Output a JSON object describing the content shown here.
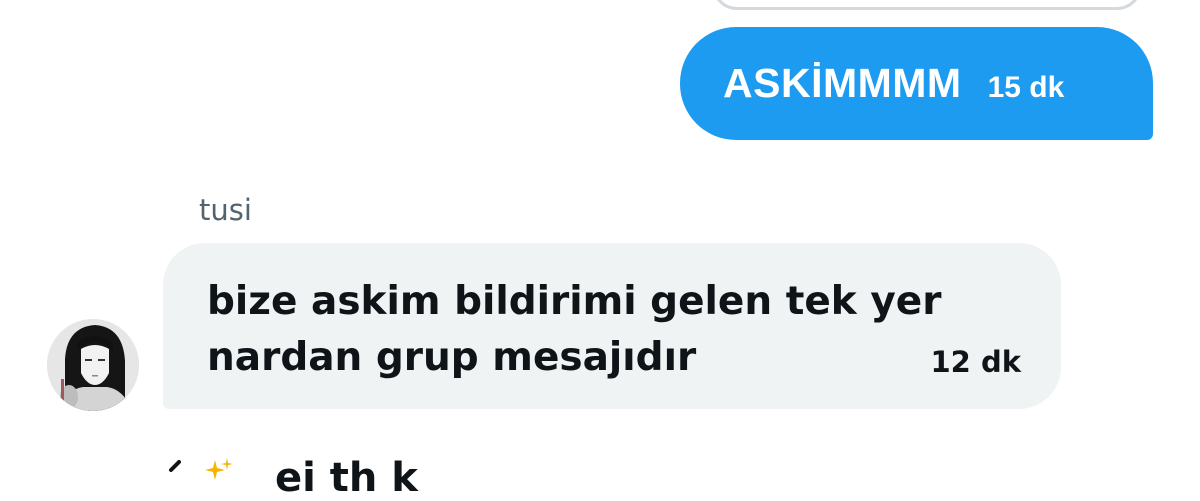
{
  "sent_message": {
    "text": "ASKİMMMM",
    "time": "15 dk",
    "color": "#1d9bf0"
  },
  "received_message": {
    "sender": "tusi",
    "lines": [
      "bize askim bildirimi gelen tek yer",
      "nardan grup mesajıdır"
    ],
    "time": "12 dk",
    "avatar_icon": "profile-avatar"
  },
  "next_row": {
    "icons": [
      "chevron-left-icon",
      "sparkle-emoji-icon"
    ],
    "partial_text": "ei    th k"
  }
}
